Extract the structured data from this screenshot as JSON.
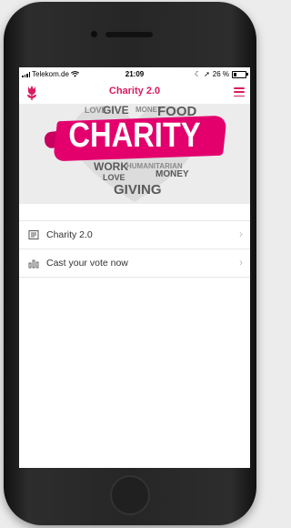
{
  "status_bar": {
    "carrier": "Telekom.de",
    "time": "21:09",
    "battery": "26 %"
  },
  "app_bar": {
    "title": "Charity 2.0",
    "logo_icon": "tulip-icon",
    "menu_icon": "hamburger-menu-icon"
  },
  "banner": {
    "headline": "CHARITY",
    "words": [
      "LOVE",
      "GIVE",
      "MONEY",
      "FOOD",
      "WORK",
      "HUMANITARIAN",
      "LOVE",
      "MONEY",
      "GIVING"
    ]
  },
  "menu_items": [
    {
      "label": "Charity 2.0",
      "icon": "document-icon"
    },
    {
      "label": "Cast your vote now",
      "icon": "bar-chart-icon"
    }
  ],
  "colors": {
    "accent": "#d81b60",
    "banner_pink": "#e3006d"
  }
}
